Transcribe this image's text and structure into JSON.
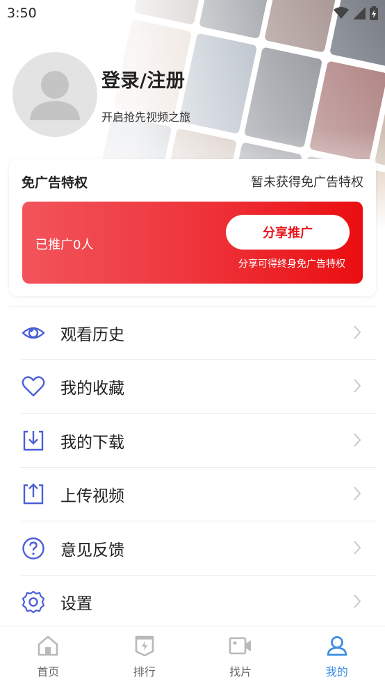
{
  "status_bar": {
    "time": "3:50"
  },
  "profile": {
    "title": "登录/注册",
    "subtitle": "开启抢先视频之旅"
  },
  "ad_free": {
    "title": "免广告特权",
    "status": "暂未获得免广告特权",
    "promoted": "已推广0人",
    "share_button": "分享推广",
    "share_note": "分享可得终身免广告特权"
  },
  "menu": [
    {
      "label": "观看历史",
      "icon": "eye-icon"
    },
    {
      "label": "我的收藏",
      "icon": "heart-icon"
    },
    {
      "label": "我的下载",
      "icon": "download-icon"
    },
    {
      "label": "上传视频",
      "icon": "upload-icon"
    },
    {
      "label": "意见反馈",
      "icon": "question-icon"
    },
    {
      "label": "设置",
      "icon": "gear-icon"
    }
  ],
  "tabs": [
    {
      "label": "首页",
      "icon": "home-icon",
      "active": false
    },
    {
      "label": "排行",
      "icon": "ranking-icon",
      "active": false
    },
    {
      "label": "找片",
      "icon": "video-camera-icon",
      "active": false
    },
    {
      "label": "我的",
      "icon": "user-icon",
      "active": true
    }
  ],
  "colors": {
    "accent": "#3a8ee6",
    "promo_red": "#ee3239",
    "menu_icon": "#4a5fd8"
  }
}
